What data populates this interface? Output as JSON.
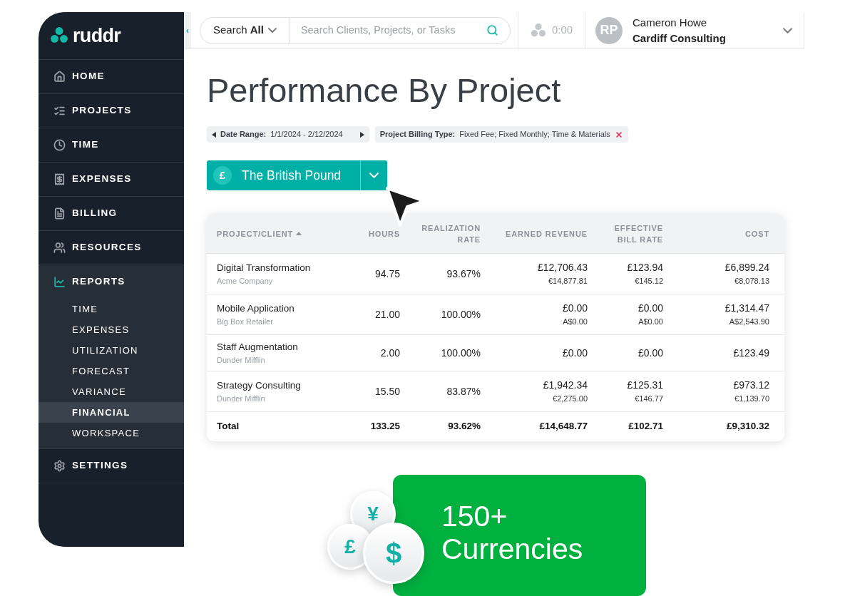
{
  "logo": {
    "text": "ruddr"
  },
  "sidebar": {
    "items": [
      {
        "label": "HOME",
        "selected": false
      },
      {
        "label": "PROJECTS",
        "selected": false
      },
      {
        "label": "TIME",
        "selected": false
      },
      {
        "label": "EXPENSES",
        "selected": false
      },
      {
        "label": "BILLING",
        "selected": false
      },
      {
        "label": "RESOURCES",
        "selected": false
      },
      {
        "label": "REPORTS",
        "selected": true,
        "expanded": true,
        "children": [
          {
            "label": "TIME",
            "selected": false
          },
          {
            "label": "EXPENSES",
            "selected": false
          },
          {
            "label": "UTILIZATION",
            "selected": false
          },
          {
            "label": "FORECAST",
            "selected": false
          },
          {
            "label": "VARIANCE",
            "selected": false
          },
          {
            "label": "FINANCIAL",
            "selected": true
          },
          {
            "label": "WORKSPACE",
            "selected": false
          }
        ]
      },
      {
        "label": "SETTINGS",
        "selected": false
      }
    ]
  },
  "top_bar": {
    "collapse": "‹",
    "search_scope": "Search **All**",
    "search": {
      "placeholder": "Search Clients, Projects, or Tasks"
    },
    "timer": "0:00",
    "user": {
      "initials": "RP",
      "name": "Cameron Howe",
      "company": "Cardiff Consulting"
    }
  },
  "title": "Performance By Project",
  "filters": [
    {
      "kind": "range",
      "label": "Date Range:",
      "value": "1/1/2024 - 2/12/2024"
    },
    {
      "kind": "removable",
      "label": "Project Billing Type:",
      "value": "Fixed Fee; Fixed Monthly; Time & Materials"
    }
  ],
  "currency": {
    "symbol": "£",
    "label": "The British Pound"
  },
  "table": {
    "columns": [
      {
        "label": "PROJECT/CLIENT",
        "sorted": true
      },
      {
        "label": "HOURS",
        "sorted": false
      },
      {
        "label": "REALIZATION RATE",
        "sorted": false
      },
      {
        "label": "EARNED REVENUE",
        "sorted": false
      },
      {
        "label": "EFFECTIVE BILL RATE",
        "sorted": false
      },
      {
        "label": "COST",
        "sorted": false
      }
    ],
    "rows": [
      {
        "project": "Digital Transformation",
        "client": "Acme Company",
        "hours": "94.75",
        "rate": "93.67%",
        "revenue": "£12,706.43",
        "revenue_alt": "€14,877.81",
        "bill_rate": "£123.94",
        "bill_rate_alt": "€145.12",
        "cost": "£6,899.24",
        "cost_alt": "€8,078.13"
      },
      {
        "project": "Mobile Application",
        "client": "Big Box Retailer",
        "hours": "21.00",
        "rate": "100.00%",
        "revenue": "£0.00",
        "revenue_alt": "A$0.00",
        "bill_rate": "£0.00",
        "bill_rate_alt": "A$0.00",
        "cost": "£1,314.47",
        "cost_alt": "A$2,543.90"
      },
      {
        "project": "Staff Augmentation",
        "client": "Dunder Mifflin",
        "hours": "2.00",
        "rate": "100.00%",
        "revenue": "£0.00",
        "bill_rate": "£0.00",
        "cost": "£123.49"
      },
      {
        "project": "Strategy Consulting",
        "client": "Dunder Mifflin",
        "hours": "15.50",
        "rate": "83.87%",
        "revenue": "£1,942.34",
        "revenue_alt": "€2,275.00",
        "bill_rate": "£125.31",
        "bill_rate_alt": "€146.77",
        "cost": "£973.12",
        "cost_alt": "€1,139.70"
      }
    ],
    "total": {
      "label": "Total",
      "hours": "133.25",
      "rate": "93.62%",
      "revenue": "£14,648.77",
      "bill_rate": "£102.71",
      "cost": "£9,310.32"
    }
  },
  "promo": {
    "coins": [
      "¥",
      "£",
      "$"
    ],
    "lines": [
      "150+",
      "Currencies"
    ]
  }
}
